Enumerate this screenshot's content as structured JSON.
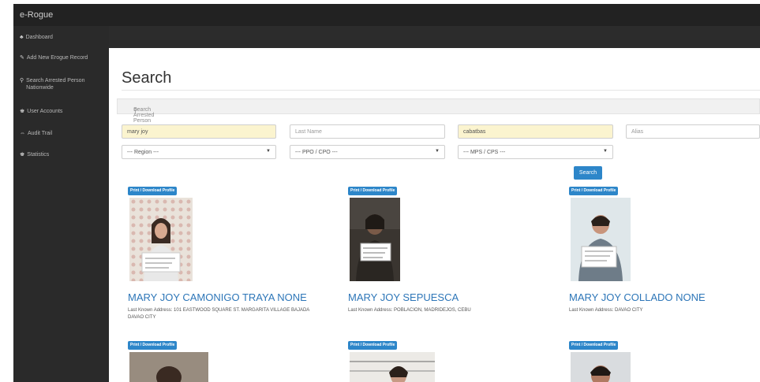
{
  "app": {
    "title": "e-Rogue"
  },
  "sidebar": {
    "items": [
      {
        "icon": "dashboard-icon",
        "glyph": "♣",
        "label": "Dashboard"
      },
      {
        "icon": "edit-icon",
        "glyph": "✎",
        "label": "Add New Erogue Record"
      },
      {
        "icon": "search-icon",
        "glyph": "⚲",
        "label": "Search Arrested Person Nationwide"
      },
      {
        "icon": "users-icon",
        "glyph": "♚",
        "label": "User Accounts"
      },
      {
        "icon": "audit-icon",
        "glyph": "⇔",
        "label": "Audit Trail"
      },
      {
        "icon": "statistics-icon",
        "glyph": "♚",
        "label": "Statistics"
      }
    ]
  },
  "main": {
    "title": "Search",
    "panel_label": "Search Arrested Person",
    "search_icon": "search-icon",
    "fields": {
      "first_name": {
        "value": "mary joy"
      },
      "last_name": {
        "placeholder": "Last Name"
      },
      "third": {
        "value": "cabatbas"
      },
      "alias": {
        "placeholder": "Alias"
      }
    },
    "selects": {
      "region": "--- Region ---",
      "ppo": "--- PPO / CPO ---",
      "mps": "--- MPS / CPS ---"
    },
    "search_button": "Search"
  },
  "results": [
    {
      "badge": "Print / Download Profile",
      "name": "MARY JOY CAMONIGO TRAYA NONE",
      "address": "Last Known Address: 101 EASTWOOD SQUARE ST. MARGARITA VILLAGE BAJADA DAVAO CITY"
    },
    {
      "badge": "Print / Download Profile",
      "name": "MARY JOY SEPUESCA",
      "address": "Last Known Address: POBLACION, MADRIDEJOS, CEBU"
    },
    {
      "badge": "Print / Download Profile",
      "name": "MARY JOY COLLADO NONE",
      "address": "Last Known Address: DAVAO CITY"
    }
  ],
  "results_row2": [
    {
      "badge": "Print / Download Profile"
    },
    {
      "badge": "Print / Download Profile"
    },
    {
      "badge": "Print / Download Profile"
    }
  ],
  "colors": {
    "accent": "#2d86c9",
    "link": "#2d76b8",
    "sidebar": "#2a2a2a",
    "topbar": "#222222",
    "highlight": "#fbf4cf"
  }
}
